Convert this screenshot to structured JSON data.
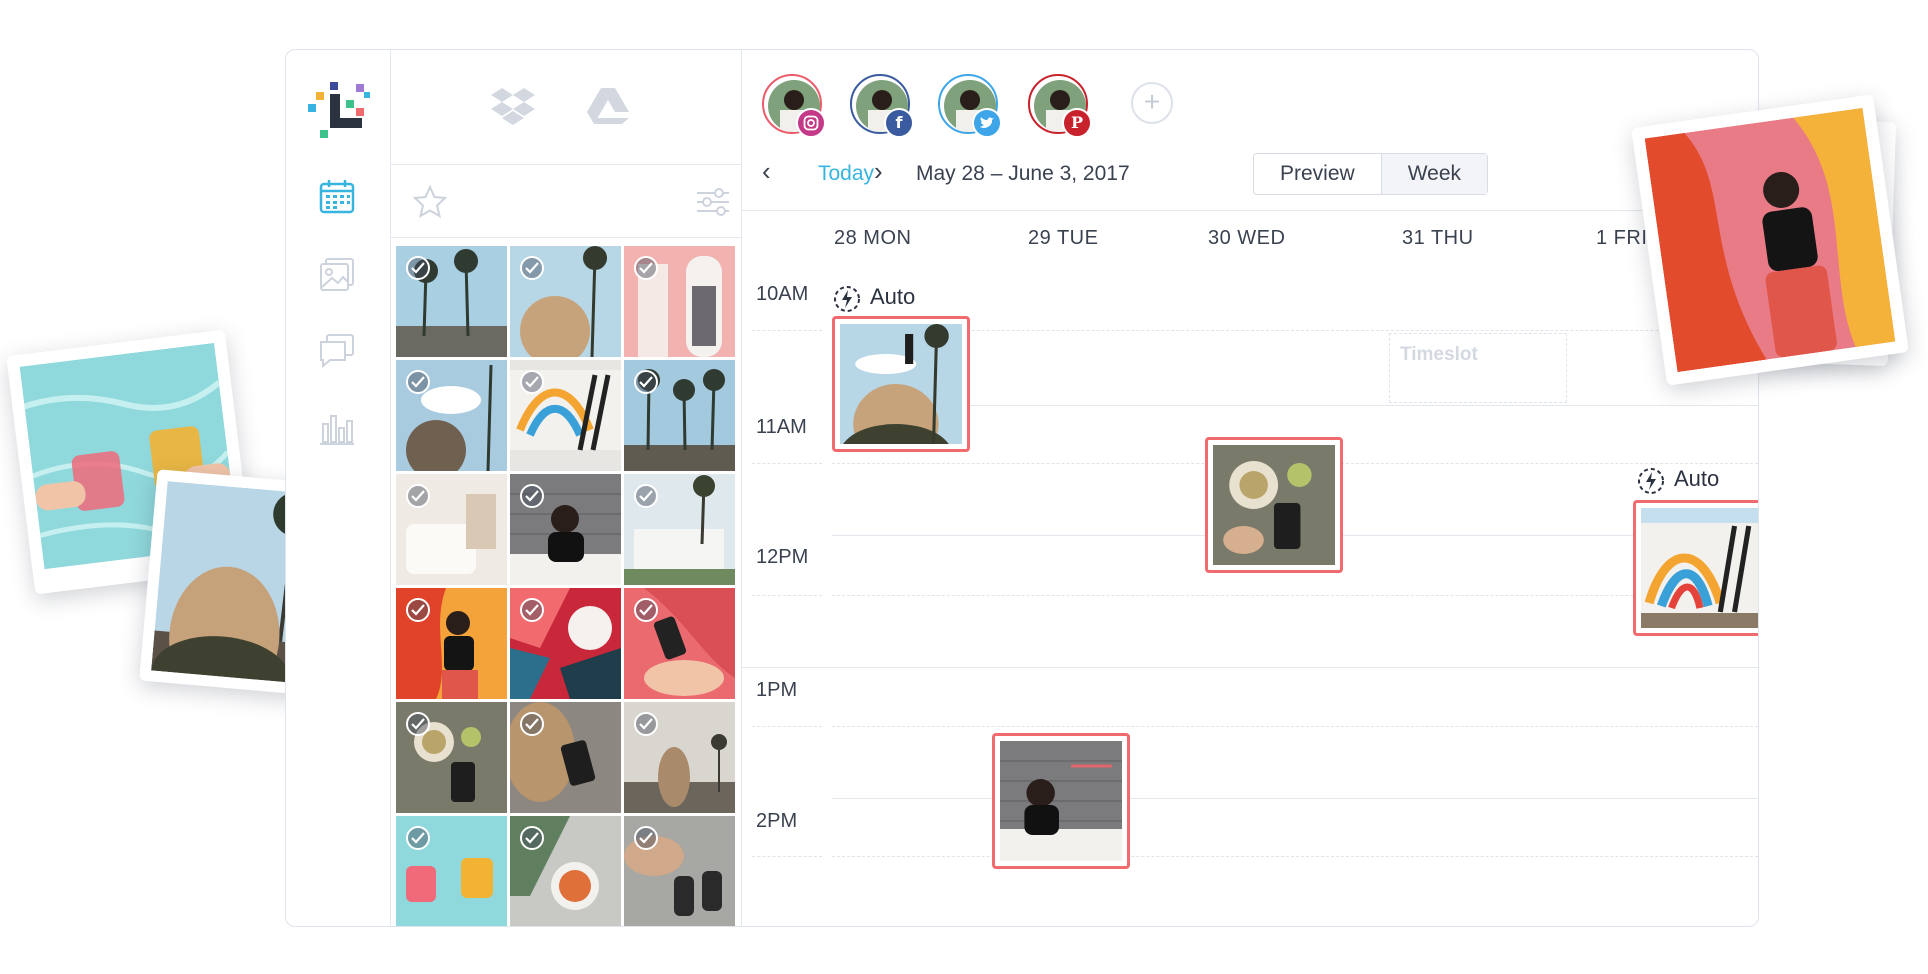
{
  "calendar": {
    "today_label": "Today",
    "date_range": "May 28 – June 3, 2017",
    "prev_arrow": "‹",
    "next_arrow": "›",
    "views": [
      "Preview",
      "Week"
    ],
    "active_view": "Week",
    "days": [
      "28 MON",
      "29 TUE",
      "30 WED",
      "31 THU",
      "1 FRI"
    ],
    "times": [
      "10AM",
      "11AM",
      "12PM",
      "1PM",
      "2PM"
    ],
    "auto_label": "Auto",
    "timeslot_label": "Timeslot"
  },
  "accounts": [
    {
      "network": "instagram",
      "badge_color": "#c43a88",
      "ring_color": "#ec5b6a"
    },
    {
      "network": "facebook",
      "badge_color": "#3a5ba0",
      "ring_color": "#3a5ba0"
    },
    {
      "network": "twitter",
      "badge_color": "#3ea6e8",
      "ring_color": "#3ea6e8"
    },
    {
      "network": "pinterest",
      "badge_color": "#c8232c",
      "ring_color": "#c8232c"
    }
  ],
  "add_account_glyph": "+",
  "library": {
    "sources": [
      "dropbox-icon",
      "google-drive-icon"
    ],
    "filter_icons": [
      "star-icon",
      "sliders-icon"
    ],
    "thumb_count": 18
  },
  "colors": {
    "accent": "#37b4e0",
    "post_border": "#f06a6e",
    "panel_border": "#e3e7ee"
  }
}
